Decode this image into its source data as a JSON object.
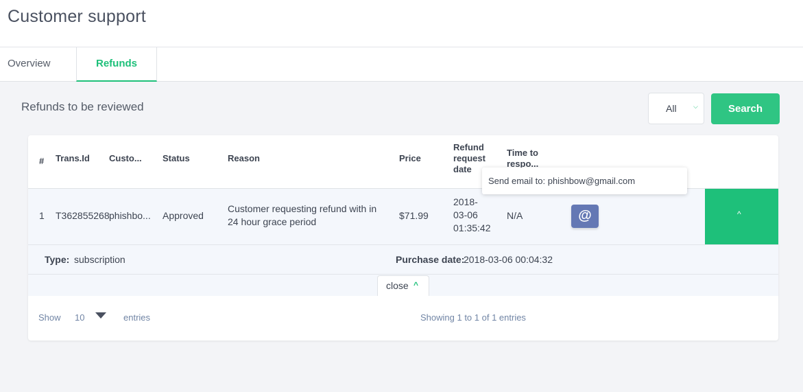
{
  "page": {
    "title": "Customer support"
  },
  "tabs": [
    {
      "label": "Overview",
      "active": false
    },
    {
      "label": "Refunds",
      "active": true
    }
  ],
  "section": {
    "title": "Refunds to be reviewed"
  },
  "filter": {
    "value": "All",
    "caret_icon": "chevron-down-icon"
  },
  "search_button": {
    "label": "Search"
  },
  "table": {
    "headers": {
      "num": "#",
      "trans_id": "Trans.Id",
      "customer": "Custo...",
      "status": "Status",
      "reason": "Reason",
      "price": "Price",
      "refund_date": "Refund request date",
      "time_to_respond": "Time to respo..."
    },
    "rows": [
      {
        "num": "1",
        "trans_id": "T362855268",
        "customer": "phishbo...",
        "status": "Approved",
        "reason": "Customer requesting refund with in 24 hour grace period",
        "price": "$71.99",
        "refund_date": "2018-03-06 01:35:42",
        "time_to_respond": "N/A",
        "email_icon": "@",
        "expand_icon": "^"
      }
    ],
    "detail": {
      "type_label": "Type:",
      "type_value": "subscription",
      "purchase_label": "Purchase date:",
      "purchase_value": "2018-03-06 00:04:32"
    },
    "close": {
      "label": "close",
      "icon": "^"
    }
  },
  "footer": {
    "show_label": "Show",
    "entries_value": "10",
    "entries_label": "entries",
    "summary": "Showing 1 to 1 of 1 entries"
  },
  "tooltip": {
    "text": "Send email to: phishbow@gmail.com"
  },
  "colors": {
    "accent": "#1ec07a",
    "email_button": "#6478b4",
    "row_bg": "#f4f7fc",
    "page_bg": "#f3f4f7"
  }
}
